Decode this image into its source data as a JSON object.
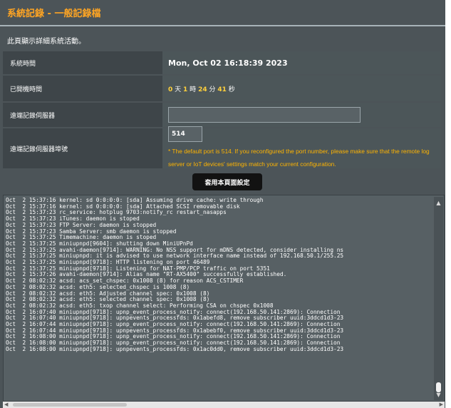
{
  "header": {
    "title": "系統記錄 - 一般記錄檔",
    "description": "此頁顯示詳細系統活動。"
  },
  "fields": {
    "system_time_label": "系統時間",
    "system_time_value": "Mon, Oct 02 16:18:39 2023",
    "uptime_label": "已開機時間",
    "uptime": {
      "days": "0",
      "days_unit": "天",
      "hours": "1",
      "hours_unit": "時",
      "minutes": "24",
      "minutes_unit": "分",
      "seconds": "41",
      "seconds_unit": "秒"
    },
    "remote_log_server_label": "遠端記錄伺服器",
    "remote_log_server_value": "",
    "remote_log_port_label": "遠端記錄伺服器埠號",
    "remote_log_port_value": "514",
    "port_hint": "* The default port is 514. If you reconfigured the port number, please make sure that the remote log server or IoT devices' settings match your current configuration."
  },
  "actions": {
    "apply_label": "套用本頁面設定"
  },
  "log": [
    "Oct  2 15:37:16 kernel: sd 0:0:0:0: [sda] Assuming drive cache: write through",
    "Oct  2 15:37:16 kernel: sd 0:0:0:0: [sda] Attached SCSI removable disk",
    "Oct  2 15:37:23 rc_service: hotplug 9703:notify_rc restart_nasapps",
    "Oct  2 15:37:23 iTunes: daemon is stoped",
    "Oct  2 15:37:23 FTP Server: daemon is stopped",
    "Oct  2 15:37:23 Samba Server: smb daemon is stopped",
    "Oct  2 15:37:25 Timemachine: daemon is stoped",
    "Oct  2 15:37:25 miniupnpd[9604]: shutting down MiniUPnPd",
    "Oct  2 15:37:25 avahi-daemon[9714]: WARNING: No NSS support for mDNS detected, consider installing ns",
    "Oct  2 15:37:25 miniupnpd: it is advised to use network interface name instead of 192.168.50.1/255.25",
    "Oct  2 15:37:25 miniupnpd[9718]: HTTP listening on port 46489",
    "Oct  2 15:37:25 miniupnpd[9718]: Listening for NAT-PMP/PCP traffic on port 5351",
    "Oct  2 15:37:26 avahi-daemon[9714]: Alias name \"RT-AX5400\" successfully established.",
    "Oct  2 08:02:32 acsd: acs_set_chspec: 0x1008 (8) for reason ACS_CSTIMER",
    "Oct  2 08:02:32 acsd: eth5: selected_chspec is 1008 (8)",
    "Oct  2 08:02:32 acsd: eth5: Adjusted channel spec: 0x1008 (8)",
    "Oct  2 08:02:32 acsd: eth5: selected channel spec: 0x1008 (8)",
    "Oct  2 08:02:32 acsd: eth5: txop channel select: Performing CSA on chspec 0x1008",
    "Oct  2 16:07:40 miniupnpd[9718]: upnp_event_process_notify: connect(192.168.50.141:2869): Connection",
    "Oct  2 16:07:40 miniupnpd[9718]: upnpevents_processfds: 0x1abefd8, remove subscriber uuid:3ddcd1d3-23",
    "Oct  2 16:07:44 miniupnpd[9718]: upnp_event_process_notify: connect(192.168.50.141:2869): Connection",
    "Oct  2 16:07:44 miniupnpd[9718]: upnpevents_processfds: 0x1abebf0, remove subscriber uuid:3ddcd1d3-23",
    "Oct  2 16:08:00 miniupnpd[9718]: upnp_event_process_notify: connect(192.168.50.141:2869): Connection",
    "Oct  2 16:08:00 miniupnpd[9718]: upnp_event_process_notify: connect(192.168.50.141:2869): Connection",
    "Oct  2 16:08:00 miniupnpd[9718]: upnpevents_processfds: 0x1ac0dd0, remove subscriber uuid:3ddcd1d3-23"
  ],
  "colors": {
    "title": "#ffa523",
    "panel_bg": "#4c5458",
    "hint": "#ffb400",
    "uptime_number": "#ffd13c"
  },
  "icons": {
    "scroll_up": "triangle-up",
    "scroll_down": "triangle-down",
    "scroll_left": "triangle-left",
    "scroll_right": "triangle-right"
  }
}
